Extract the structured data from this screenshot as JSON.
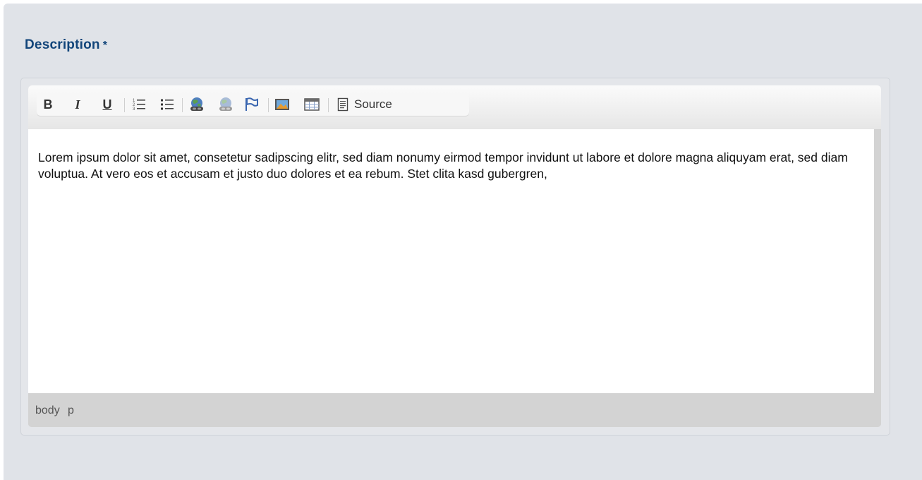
{
  "field": {
    "label": "Description",
    "required_mark": "*"
  },
  "toolbar": {
    "buttons": [
      {
        "name": "bold-button",
        "icon": "bold-icon",
        "glyph": "B"
      },
      {
        "name": "italic-button",
        "icon": "italic-icon",
        "glyph": "I"
      },
      {
        "name": "underline-button",
        "icon": "underline-icon",
        "glyph": "U"
      },
      {
        "name": "numbered-list-button",
        "icon": "numbered-list-icon"
      },
      {
        "name": "bulleted-list-button",
        "icon": "bulleted-list-icon"
      },
      {
        "name": "link-button",
        "icon": "link-icon"
      },
      {
        "name": "unlink-button",
        "icon": "unlink-icon"
      },
      {
        "name": "anchor-button",
        "icon": "anchor-flag-icon"
      },
      {
        "name": "image-button",
        "icon": "image-icon"
      },
      {
        "name": "table-button",
        "icon": "table-icon"
      }
    ],
    "source_label": "Source"
  },
  "editor": {
    "content": "Lorem ipsum dolor sit amet, consetetur sadipscing elitr, sed diam nonumy eirmod tempor invidunt ut labore et dolore magna aliquyam erat, sed diam voluptua. At vero eos et accusam et justo duo dolores et ea rebum. Stet clita kasd gubergren,"
  },
  "path": {
    "items": [
      "body",
      "p"
    ]
  },
  "colors": {
    "label": "#12457a",
    "panel_bg": "#e0e3e8",
    "content_bg": "#ffffff",
    "path_bar_bg": "#d3d3d3"
  }
}
